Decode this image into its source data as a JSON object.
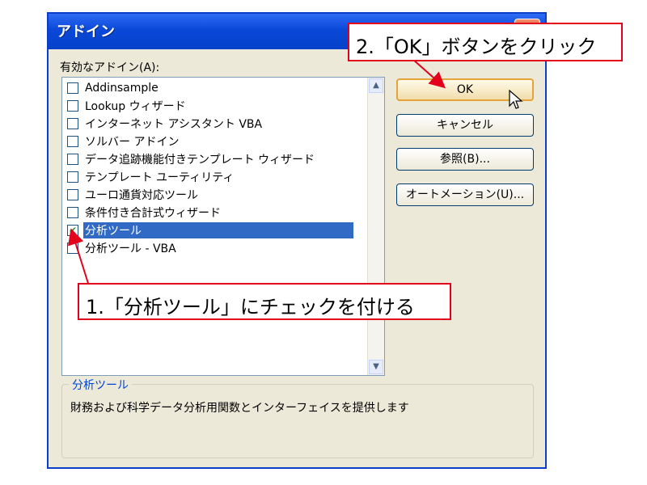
{
  "window": {
    "title": "アドイン",
    "close": "×"
  },
  "addin_list": {
    "label": "有効なアドイン(A):",
    "items": [
      {
        "label": "Addinsample",
        "checked": false,
        "selected": false
      },
      {
        "label": "Lookup ウィザード",
        "checked": false,
        "selected": false
      },
      {
        "label": "インターネット アシスタント VBA",
        "checked": false,
        "selected": false
      },
      {
        "label": "ソルバー アドイン",
        "checked": false,
        "selected": false
      },
      {
        "label": "データ追跡機能付きテンプレート ウィザード",
        "checked": false,
        "selected": false
      },
      {
        "label": "テンプレート ユーティリティ",
        "checked": false,
        "selected": false
      },
      {
        "label": "ユーロ通貨対応ツール",
        "checked": false,
        "selected": false
      },
      {
        "label": "条件付き合計式ウィザード",
        "checked": false,
        "selected": false
      },
      {
        "label": "分析ツール",
        "checked": true,
        "selected": true
      },
      {
        "label": "分析ツール - VBA",
        "checked": false,
        "selected": false
      }
    ]
  },
  "buttons": {
    "ok": "OK",
    "cancel": "キャンセル",
    "browse": "参照(B)...",
    "automation": "オートメーション(U)..."
  },
  "description": {
    "title": "分析ツール",
    "text": "財務および科学データ分析用関数とインターフェイスを提供します"
  },
  "annotations": {
    "step1": "1.「分析ツール」にチェックを付ける",
    "step2": "2.「OK」ボタンをクリック"
  },
  "icons": {
    "check": "checkmark-icon",
    "scroll_up": "scroll-up-icon",
    "scroll_down": "scroll-down-icon",
    "cursor": "mouse-pointer-icon"
  },
  "colors": {
    "titlebar": "#0a48d8",
    "selection": "#316ac5",
    "callout_border": "#e3001b",
    "default_button_border": "#e5a33a"
  }
}
